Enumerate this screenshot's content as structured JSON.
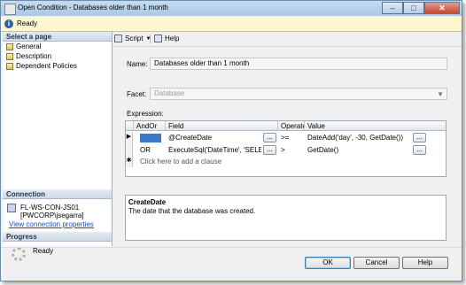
{
  "window": {
    "title": "Open Condition - Databases older than 1 month"
  },
  "status": {
    "text": "Ready"
  },
  "left_pane": {
    "select_page_header": "Select a page",
    "pages": [
      {
        "label": "General",
        "icon": "page-icon"
      },
      {
        "label": "Description",
        "icon": "page-icon"
      },
      {
        "label": "Dependent Policies",
        "icon": "page-icon"
      }
    ],
    "connection_header": "Connection",
    "connection_server": "FL-WS-CON-JS01",
    "connection_user": "[PWCORP\\jsegarra]",
    "connection_link": "View connection properties",
    "progress_header": "Progress",
    "progress_status": "Ready"
  },
  "toolbar": {
    "script_label": "Script",
    "help_label": "Help"
  },
  "form": {
    "name_label": "Name:",
    "name_value": "Databases older than 1 month",
    "facet_label": "Facet:",
    "facet_value": "Database",
    "expression_label": "Expression:"
  },
  "expression_grid": {
    "columns": [
      "AndOr",
      "Field",
      "Operato",
      "Value"
    ],
    "rows": [
      {
        "selector": "▶",
        "andor": "",
        "field": "@CreateDate",
        "operator": ">=",
        "value": "DateAdd('day', -30, GetDate())"
      },
      {
        "selector": "",
        "andor": "OR",
        "field": "ExecuteSql('DateTime', 'SELECT",
        "operator": ">",
        "value": "GetDate()"
      }
    ],
    "new_row_marker": "✱",
    "new_row_text": "Click here to add a clause",
    "ellipsis": "..."
  },
  "description": {
    "title": "CreateDate",
    "text": "The date that the database was created."
  },
  "buttons": {
    "ok": "OK",
    "cancel": "Cancel",
    "help": "Help"
  },
  "colors": {
    "accent": "#3a78c9",
    "status_bg": "#fdf7d0",
    "link": "#1a4fb0"
  }
}
